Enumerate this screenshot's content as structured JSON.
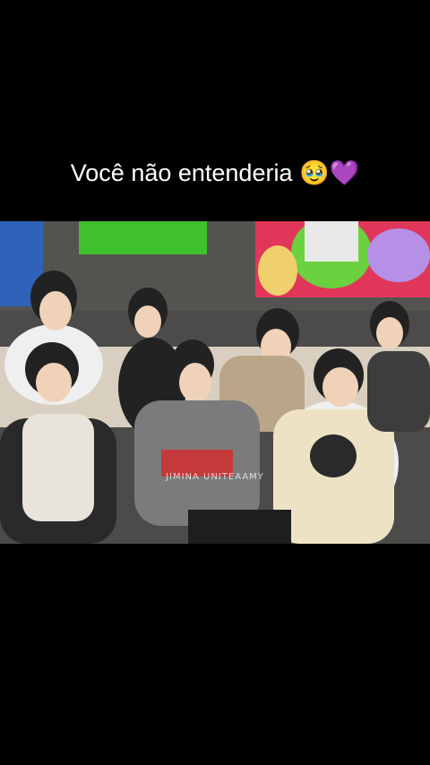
{
  "caption": {
    "text": "Você não entenderia 🥹💜"
  },
  "video": {
    "watermark": "JIMINA UNITEAAMY"
  }
}
